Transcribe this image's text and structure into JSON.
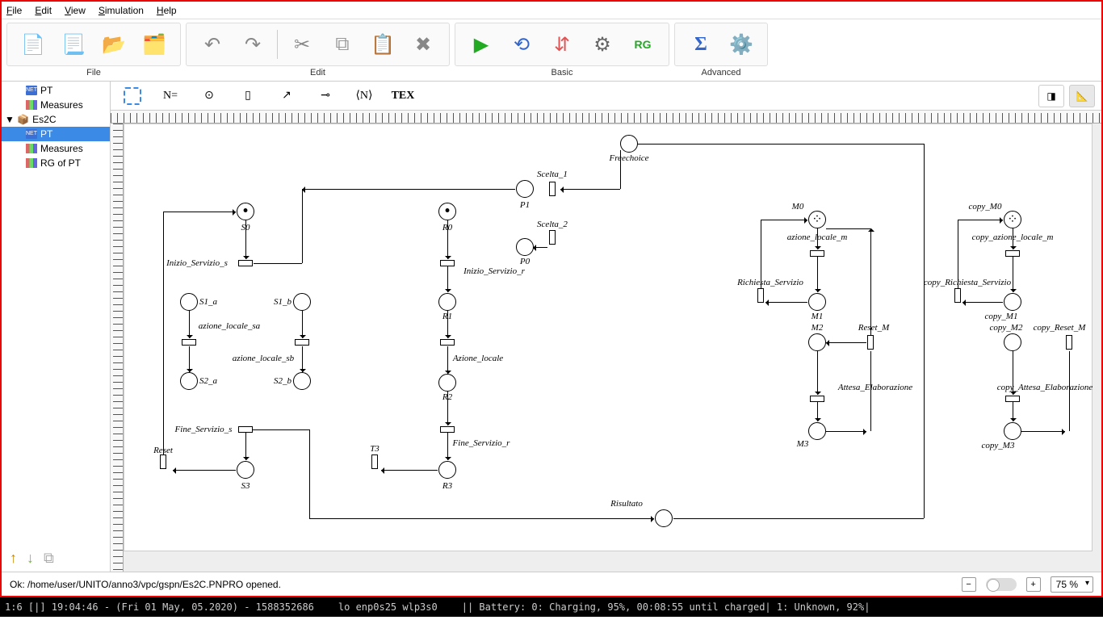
{
  "menu": {
    "file": "File",
    "edit": "Edit",
    "view": "View",
    "sim": "Simulation",
    "help": "Help"
  },
  "toolbar_groups": {
    "file": "File",
    "edit": "Edit",
    "basic": "Basic",
    "advanced": "Advanced"
  },
  "tree": {
    "pt_top": "PT",
    "measures_top": "Measures",
    "project": "Es2C",
    "pt": "PT",
    "measures": "Measures",
    "rg": "RG of PT"
  },
  "tool2": {
    "neq": "N=",
    "angle": "⟨N⟩",
    "tex": "TEX"
  },
  "status": {
    "msg": "Ok: /home/user/UNITO/anno3/vpc/gspn/Es2C.PNPRO opened.",
    "zoom": "75 %"
  },
  "taskbar": {
    "left": "1:6 [|]   19:04:46 - (Fri 01 May, 05.2020) - 1588352686",
    "mid": "lo enp0s25 wlp3s0",
    "right": "||  Battery: 0: Charging, 95%, 00:08:55 until charged| 1: Unknown, 92%|"
  },
  "net": {
    "places": {
      "S0": "S0",
      "S1a": "S1_a",
      "S1b": "S1_b",
      "S2a": "S2_a",
      "S2b": "S2_b",
      "S3": "S3",
      "R0": "R0",
      "R1": "R1",
      "R2": "R2",
      "R3": "R3",
      "P0": "P0",
      "P1": "P1",
      "Freechoice": "Freechoice",
      "Risultato": "Risultato",
      "M0": "M0",
      "M1": "M1",
      "M2": "M2",
      "M3": "M3",
      "cM0": "copy_M0",
      "cM1": "copy_M1",
      "cM2": "copy_M2",
      "cM3": "copy_M3"
    },
    "trans": {
      "Inizio_s": "Inizio_Servizio_s",
      "az_sa": "azione_locale_sa",
      "az_sb": "azione_locale_sb",
      "Fine_s": "Fine_Servizio_s",
      "Reset": "Reset",
      "Scelta1": "Scelta_1",
      "Scelta2": "Scelta_2",
      "Inizio_r": "Inizio_Servizio_r",
      "Az_loc": "Azione_locale",
      "Fine_r": "Fine_Servizio_r",
      "T3": "T3",
      "az_m": "azione_locale_m",
      "Rich": "Richiesta_Servizio",
      "Attesa": "Attesa_Elaborazione",
      "ResetM": "Reset_M",
      "caz_m": "copy_azione_locale_m",
      "cRich": "copy_Richiesta_Servizio",
      "cAttesa": "copy_Attesa_Elaborazione",
      "cResetM": "copy_Reset_M"
    }
  }
}
